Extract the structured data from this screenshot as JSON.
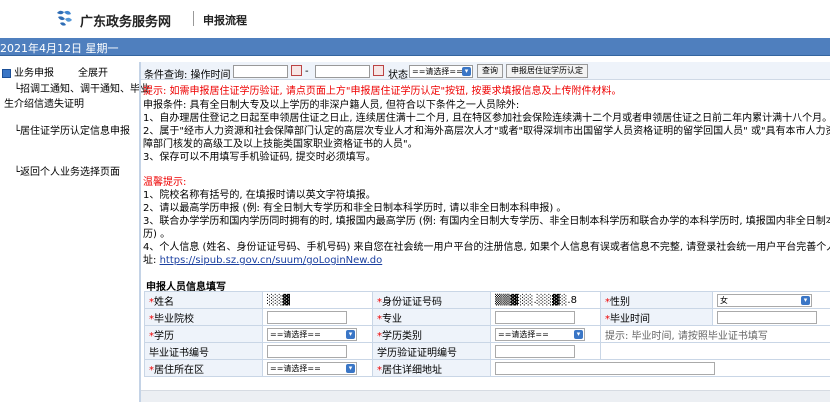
{
  "header": {
    "site_name": "广东政务服务网",
    "page_name": "申报流程"
  },
  "datebar": {
    "date": "2021年4月12日 星期一"
  },
  "sidebar": {
    "root": "业务申报",
    "expand_all": "全展开",
    "items": [
      "└招调工通知、调干通知、毕业",
      "生介绍信遗失证明",
      "└居住证学历认定信息申报",
      "└返回个人业务选择页面"
    ]
  },
  "filter": {
    "label": "条件查询: 操作时间",
    "dash": "-",
    "status_label": "状态",
    "status_value": "==请选择==",
    "query_button": "查询",
    "apply_button": "申报居住证学历认定"
  },
  "tip": "提示: 如需申报居住证学历验证, 请点页面上方\"申报居住证学历认定\"按钮, 按要求填报信息及上传附件材料。",
  "notice": {
    "lines": [
      "申报条件: 具有全日制大专及以上学历的非深户籍人员, 但符合以下条件之一人员除外:",
      "1、自办理居住登记之日起至申领居住证之日止, 连续居住满十二个月, 且在特区参加社会保险连续满十二个月或者申领居住证之日前二年内累计满十八个月。",
      "2、属于\"经市人力资源和社会保障部门认定的高层次专业人才和海外高层次人才\"或者\"取得深圳市出国留学人员资格证明的留学回国人员\" 或\"具有本市人力资源",
      "障部门核发的高级工及以上技能类国家职业资格证书的人员\"。",
      "3、保存可以不用填写手机验证码, 提交时必须填写。"
    ],
    "warm_title": "温馨提示:",
    "warm_lines": [
      "1、院校名称有括号的, 在填报时请以英文字符填报。",
      "2、请以最高学历申报 (例: 有全日制大专学历和非全日制本科学历时, 请以非全日制本科申报) 。",
      "3、联合办学学历和国内学历同时拥有的时, 填报国内最高学历 (例: 有国内全日制大专学历、非全日制本科学历和联合办学的本科学历时, 填报国内非全日制本科学",
      "历) 。",
      "4、个人信息 (姓名、身份证证号码、手机号码) 来自您在社会统一用户平台的注册信息, 如果个人信息有误或者信息不完整, 请登录社会统一用户平台完善个人信息。网"
    ],
    "url_prefix": "址: ",
    "url": "https://sipub.sz.gov.cn/suum/goLoginNew.do"
  },
  "form": {
    "title": "申报人员信息填写",
    "labels": {
      "name": "姓名",
      "id": "身份证证号码",
      "gender": "性别",
      "school": "毕业院校",
      "major": "专业",
      "grad_time": "毕业时间",
      "edu": "学历",
      "edu_type": "学历类别",
      "cert_no": "毕业证书编号",
      "verify_no": "学历验证证明编号",
      "residence": "居住所在区",
      "address": "居住详细地址"
    },
    "values": {
      "name": "░░▓",
      "id": "▒▒▓░░.░░▓░.8",
      "gender": "女",
      "edu": "==请选择==",
      "edu_type": "==请选择==",
      "residence": "==请选择=="
    },
    "hint": "提示: 毕业时间, 请按照毕业证书填写",
    "required_mark": "*"
  }
}
